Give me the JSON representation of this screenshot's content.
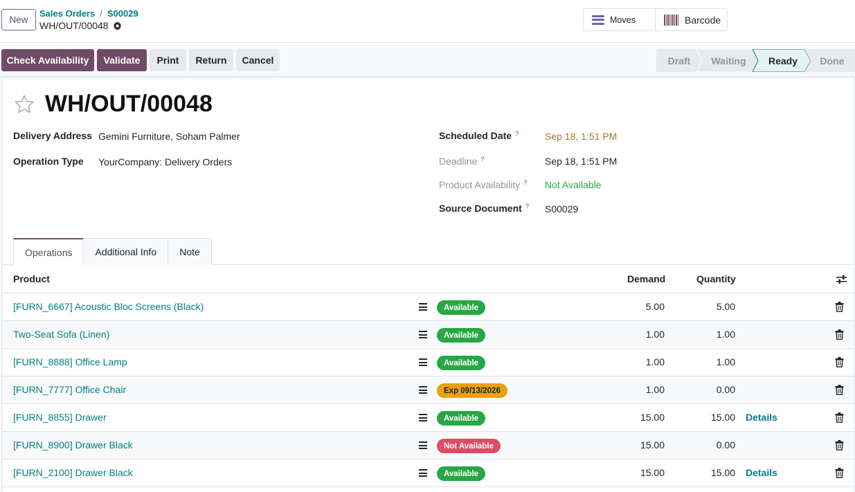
{
  "control_panel": {
    "new_label": "New",
    "breadcrumb": [
      "Sales Orders",
      "S00029"
    ],
    "breadcrumb_sep": "/",
    "record_name": "WH/OUT/00048",
    "smart_buttons": {
      "moves": "Moves",
      "barcode": "Barcode"
    }
  },
  "actions": {
    "check_availability": "Check Availability",
    "validate": "Validate",
    "print": "Print",
    "return": "Return",
    "cancel": "Cancel"
  },
  "stages": [
    {
      "label": "Draft",
      "state": "past"
    },
    {
      "label": "Waiting",
      "state": "past"
    },
    {
      "label": "Ready",
      "state": "current"
    },
    {
      "label": "Done",
      "state": "future"
    }
  ],
  "form": {
    "title": "WH/OUT/00048",
    "left_fields": [
      {
        "label": "Delivery Address",
        "value": "Gemini Furniture, Soham Palmer"
      },
      {
        "label": "Operation Type",
        "value": "YourCompany: Delivery Orders"
      }
    ],
    "right_fields": [
      {
        "label": "Scheduled Date",
        "help": "?",
        "value": "Sep 18, 1:51 PM",
        "value_style": "warning"
      },
      {
        "label": "Deadline",
        "help": "?",
        "value": "Sep 18, 1:51 PM",
        "label_style": "muted"
      },
      {
        "label": "Product Availability",
        "help": "?",
        "value": "Not Available",
        "label_style": "muted",
        "value_style": "success"
      },
      {
        "label": "Source Document",
        "help": "?",
        "value": "S00029"
      }
    ]
  },
  "tabs": [
    {
      "label": "Operations",
      "active": true
    },
    {
      "label": "Additional Info",
      "active": false
    },
    {
      "label": "Note",
      "active": false
    }
  ],
  "table": {
    "headers": {
      "product": "Product",
      "demand": "Demand",
      "quantity": "Quantity"
    },
    "rows": [
      {
        "product": "[FURN_6667] Acoustic Bloc Screens (Black)",
        "badge": "Available",
        "badge_color": "#28a745",
        "demand": "5.00",
        "quantity": "5.00",
        "details": ""
      },
      {
        "product": "Two-Seat Sofa (Linen)",
        "badge": "Available",
        "badge_color": "#28a745",
        "demand": "1.00",
        "quantity": "1.00",
        "details": ""
      },
      {
        "product": "[FURN_8888] Office Lamp",
        "badge": "Available",
        "badge_color": "#28a745",
        "demand": "1.00",
        "quantity": "1.00",
        "details": ""
      },
      {
        "product": "[FURN_7777] Office Chair",
        "badge": "Exp 09/13/2026",
        "badge_color": "#e9a10d",
        "badge_text_color": "#212529",
        "demand": "1.00",
        "quantity": "0.00",
        "details": ""
      },
      {
        "product": "[FURN_8855] Drawer",
        "badge": "Available",
        "badge_color": "#28a745",
        "demand": "15.00",
        "quantity": "15.00",
        "details": "Details"
      },
      {
        "product": "[FURN_8900] Drawer Black",
        "badge": "Not Available",
        "badge_color": "#dc4c64",
        "demand": "15.00",
        "quantity": "0.00",
        "details": ""
      },
      {
        "product": "[FURN_2100] Drawer Black",
        "badge": "Available",
        "badge_color": "#28a745",
        "demand": "15.00",
        "quantity": "15.00",
        "details": "Details"
      }
    ]
  },
  "colors": {
    "primary": "#714b67",
    "link": "#017e84"
  }
}
